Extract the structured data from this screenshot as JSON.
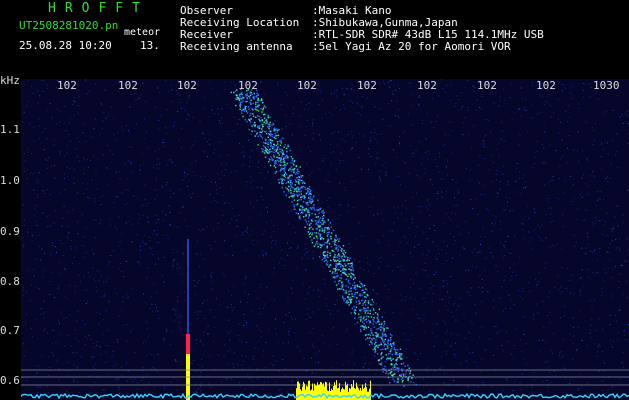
{
  "header": {
    "logo": "HROFFT",
    "filename": "UT2508281020.pn",
    "category": "meteor",
    "datetime": "25.08.28 10:20",
    "code": "13.",
    "fields": [
      {
        "label": "Observer",
        "value": ":Masaki Kano"
      },
      {
        "label": "Receiving Location",
        "value": ":Shibukawa,Gunma,Japan"
      },
      {
        "label": "Receiver",
        "value": ":RTL-SDR SDR# 43dB L15 114.1MHz USB"
      },
      {
        "label": "Receiving antenna",
        "value": ":5el Yagi Az 20 for Aomori VOR"
      }
    ]
  },
  "spectrogram": {
    "y_unit": "kHz",
    "y_ticks": [
      "1.1",
      "1.0",
      "0.9",
      "0.8",
      "0.7",
      "0.6"
    ],
    "x_ticks": [
      "102",
      "102",
      "102",
      "102",
      "102",
      "102",
      "102",
      "102",
      "102",
      "1030"
    ],
    "colors": {
      "background": "#06062a",
      "noise": "#1a2c8a",
      "echo_blue": "#2a6cff",
      "echo_cyan": "#3fe0d0",
      "echo_green": "#40e070",
      "baseline": "#33d6ff",
      "burst": "#ffff00",
      "red_spot": "#ff2050"
    }
  }
}
